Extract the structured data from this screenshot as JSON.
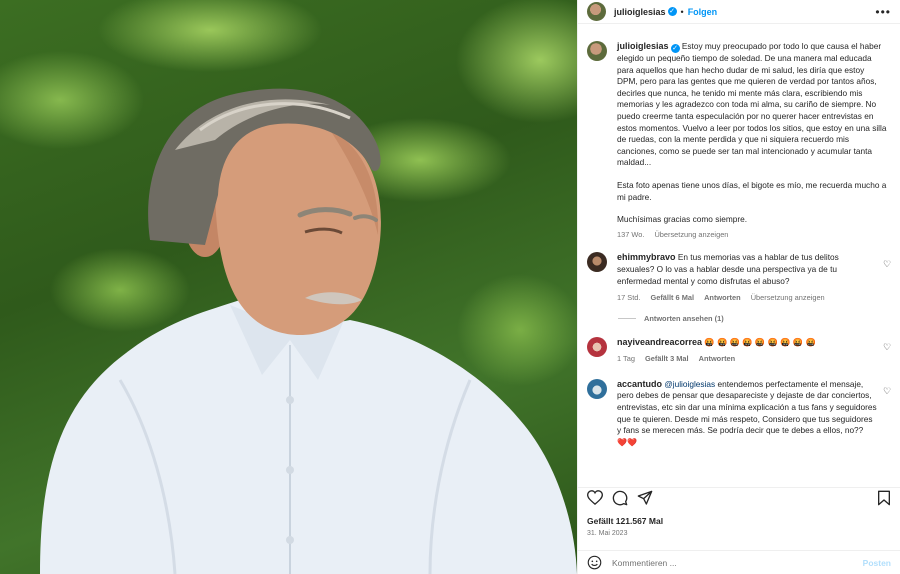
{
  "post": {
    "username": "julioiglesias",
    "verified_mark": "✓",
    "separator": "•",
    "follow_label": "Folgen",
    "more_icon": "more-horizontal-icon",
    "photo_alt": "Portrait of a man with grey hair in a white shirt on a green background"
  },
  "caption": {
    "username": "julioiglesias",
    "paragraphs": [
      "Estoy muy preocupado por todo lo que causa el haber elegido un pequeño tiempo de soledad. De una manera mal educada para aquellos que han hecho dudar de mi salud, les diría que estoy DPM, pero para las gentes que me quieren de verdad por tantos años, decirles que nunca, he tenido mi mente más clara, escribiendo mis memorias y les agradezco con toda mi alma, su cariño de siempre. No puedo creerme tanta especulación por no querer hacer entrevistas en estos momentos. Vuelvo a leer por todos los sitios, que estoy en una silla de ruedas, con la mente perdida y que ni siquiera recuerdo mis canciones, como se puede ser tan mal intencionado y acumular tanta maldad...",
      "Esta foto apenas tiene unos días, el bigote es mío, me recuerda mucho a mi padre.",
      "Muchísimas gracias como siempre."
    ],
    "time": "137 Wo.",
    "translate": "Übersetzung anzeigen"
  },
  "comments": [
    {
      "username": "ehimmybravo",
      "text": "En tus memorias vas a hablar de tus delitos sexuales? O lo vas a hablar desde una perspectiva ya de tu enfermedad mental y como disfrutas el abuso?",
      "time": "17 Std.",
      "likes": "Gefällt 6 Mal",
      "reply": "Antworten",
      "translate": "Übersetzung anzeigen",
      "view_replies": "Antworten ansehen (1)"
    },
    {
      "username": "nayiveandreacorrea",
      "text": "🤬 🤬 🤬 🤬 🤬 🤬 🤬 🤬 🤬",
      "time": "1 Tag",
      "likes": "Gefällt 3 Mal",
      "reply": "Antworten"
    },
    {
      "username": "accantudo",
      "mention": "@julioiglesias",
      "text": " entendemos perfectamente el mensaje, pero debes de pensar que desapareciste y dejaste de dar conciertos, entrevistas, etc sin dar una mínima explicación a tus fans y seguidores que te quieren. Desde mi más respeto, Considero que tus seguidores y fans se merecen más. Se podría decir que te debes a ellos, no??",
      "trailing": "❤️❤️"
    }
  ],
  "footer": {
    "likes": "Gefällt 121.567 Mal",
    "date": "31. Mai 2023",
    "comment_placeholder": "Kommentieren ...",
    "post_label": "Posten"
  },
  "colors": {
    "accent": "#0095f6",
    "text": "#262626",
    "muted": "#737373"
  }
}
